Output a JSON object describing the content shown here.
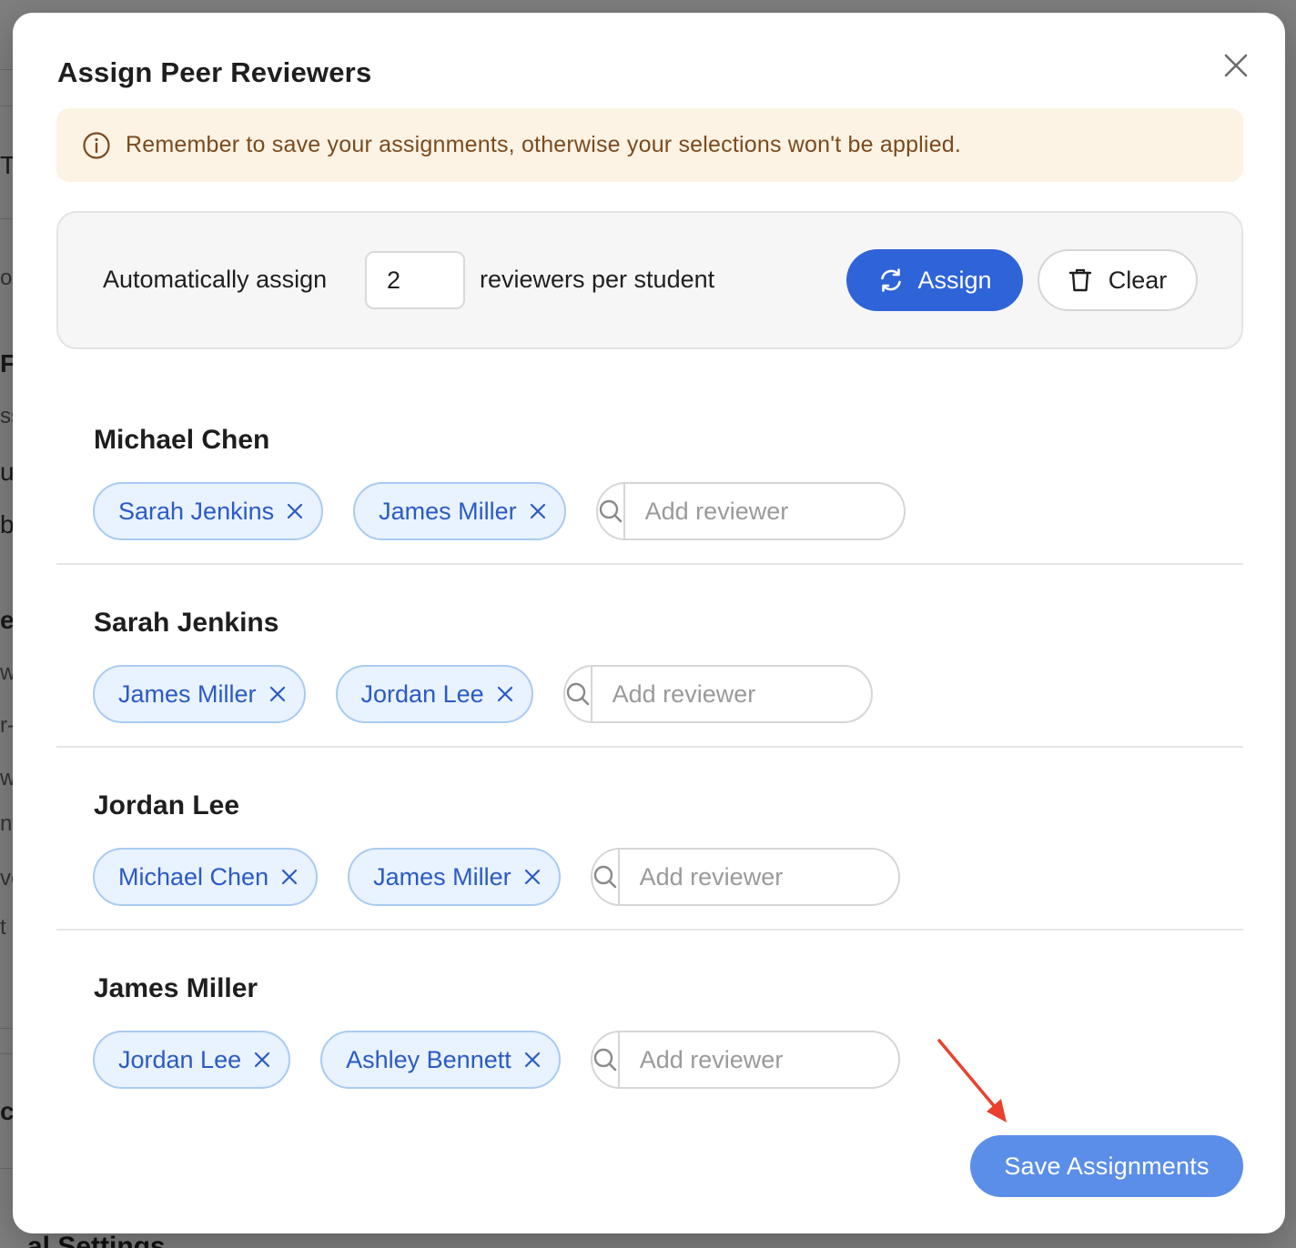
{
  "background_page": {
    "fragments": [
      "Ty",
      "or",
      "F",
      "ss",
      "ul",
      "b",
      "ev",
      "w",
      "r-",
      "wi",
      "nt",
      "ve",
      "t",
      "ck"
    ],
    "bottom_text": "al Settings"
  },
  "modal": {
    "title": "Assign Peer Reviewers",
    "banner": {
      "text": "Remember to save your assignments, otherwise your selections won't be applied.",
      "bg_color": "#fdf3e4",
      "text_color": "#7a4a1e"
    },
    "auto_assign": {
      "label_before": "Automatically assign",
      "count_value": "2",
      "label_after": "reviewers per student",
      "assign_label": "Assign",
      "clear_label": "Clear"
    },
    "students": [
      {
        "name": "Michael Chen",
        "reviewers": [
          "Sarah Jenkins",
          "James Miller"
        ],
        "search_placeholder": "Add reviewer"
      },
      {
        "name": "Sarah Jenkins",
        "reviewers": [
          "James Miller",
          "Jordan Lee"
        ],
        "search_placeholder": "Add reviewer"
      },
      {
        "name": "Jordan Lee",
        "reviewers": [
          "Michael Chen",
          "James Miller"
        ],
        "search_placeholder": "Add reviewer"
      },
      {
        "name": "James Miller",
        "reviewers": [
          "Jordan Lee",
          "Ashley Bennett"
        ],
        "search_placeholder": "Add reviewer"
      }
    ],
    "save_label": "Save Assignments"
  },
  "colors": {
    "primary": "#2f63d8",
    "save_button": "#5b8ee8",
    "chip_bg": "#e9f2ff",
    "chip_text": "#2a5bc4",
    "annotation_arrow": "#e8422f"
  },
  "icons": {
    "close": "close-icon",
    "info": "info-icon",
    "refresh": "refresh-icon",
    "trash": "trash-icon",
    "remove": "x-icon",
    "search": "search-icon"
  }
}
